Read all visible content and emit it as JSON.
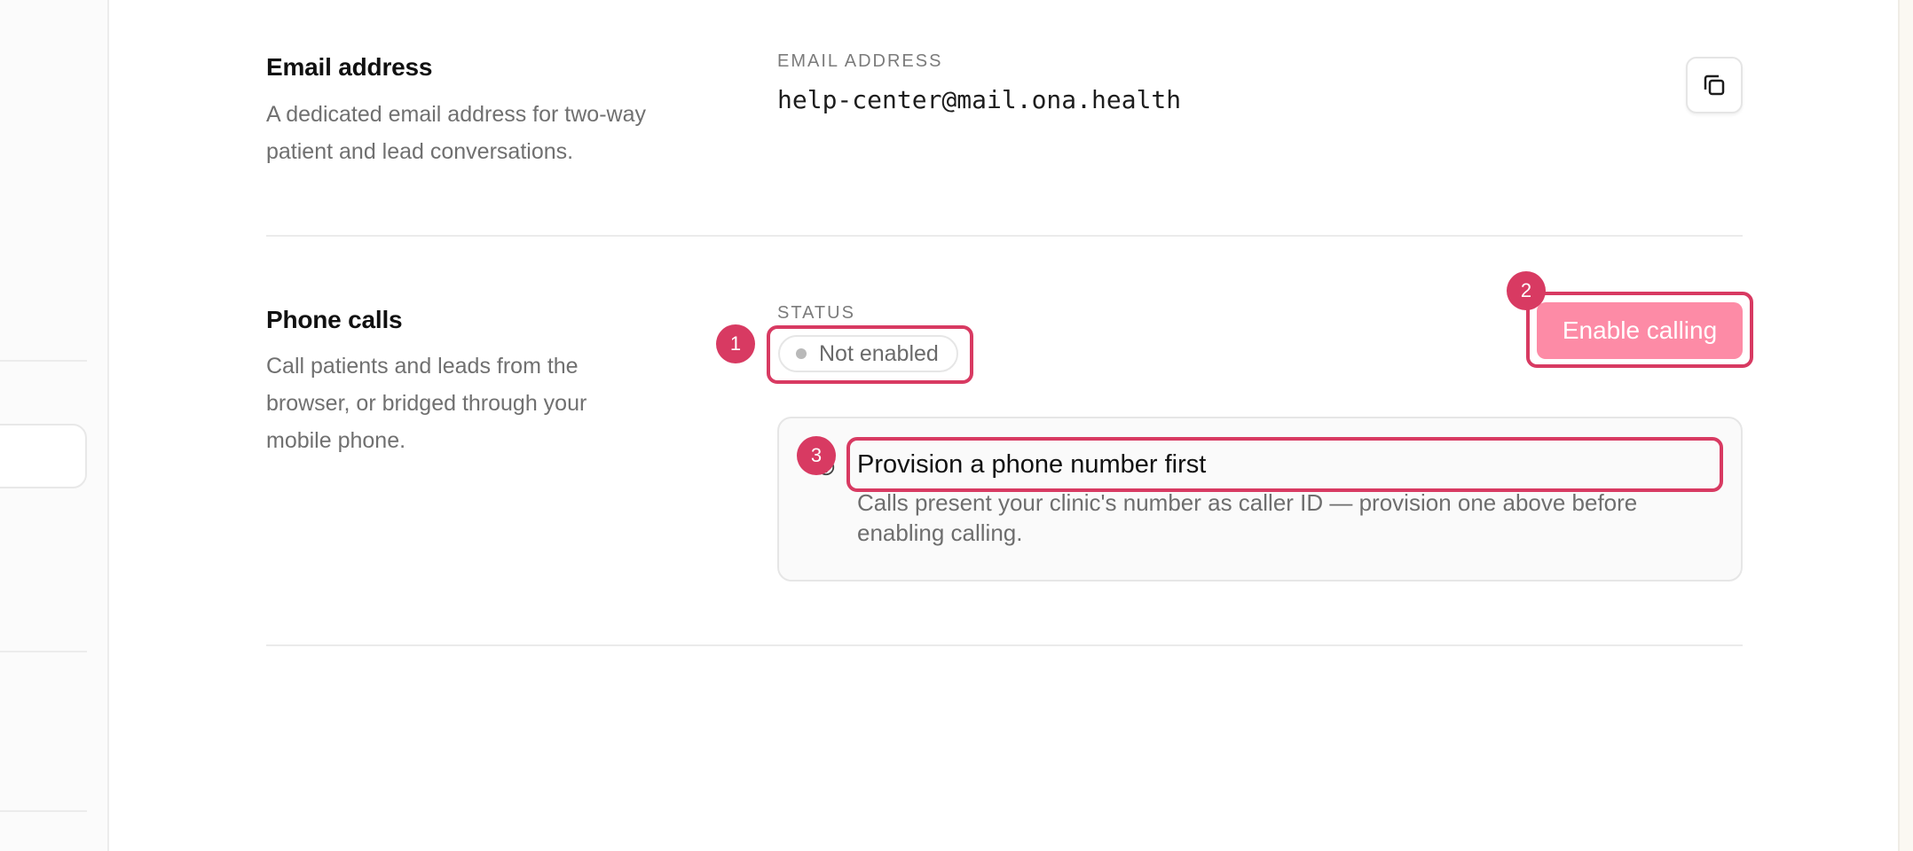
{
  "email_section": {
    "title": "Email address",
    "description": "A dedicated email address for two-way patient and lead conversations.",
    "field_label": "EMAIL ADDRESS",
    "email": "help-center@mail.ona.health",
    "copy_icon": "copy-icon"
  },
  "phone_section": {
    "title": "Phone calls",
    "description": "Call patients and leads from the browser, or bridged through your mobile phone.",
    "status_label": "STATUS",
    "status_value": "Not enabled",
    "enable_button_label": "Enable calling",
    "notice": {
      "title": "Provision a phone number first",
      "description": "Calls present your clinic's number as caller ID — provision one above before enabling calling.",
      "icon": "alert-icon"
    }
  },
  "annotations": [
    {
      "number": "1"
    },
    {
      "number": "2"
    },
    {
      "number": "3"
    }
  ],
  "colors": {
    "accent": "#d83a62",
    "button": "#fd8ba6",
    "muted_text": "#707070"
  }
}
